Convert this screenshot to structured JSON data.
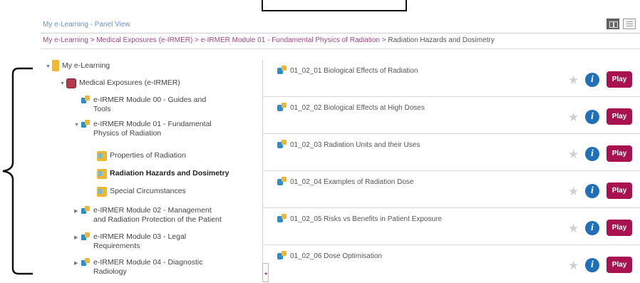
{
  "page_title": "My e-Learning - Panel View",
  "view_toggle": {
    "panel_icon": "panel-view-icon",
    "list_icon": "list-view-icon"
  },
  "breadcrumb": {
    "path": "My e-Learning > Medical Exposures (e-IRMER) > e-IRMER Module 01 - Fundamental Physics of Radiation > ",
    "current": "Radiation Hazards and Dosimetry"
  },
  "tree": {
    "root": "My e-Learning",
    "course": "Medical Exposures (e-IRMER)",
    "module00": [
      "e-IRMER Module 00 - Guides and",
      "Tools"
    ],
    "module01": [
      "e-IRMER Module 01 - Fundamental",
      "Physics of Radiation"
    ],
    "topic1": "Properties of Radiation",
    "topic2": "Radiation Hazards and Dosimetry",
    "topic3": "Special Circumstances",
    "module02": [
      "e-IRMER Module 02 - Management",
      "and Radiation Protection of the Patient"
    ],
    "module03": [
      "e-IRMER Module 03 - Legal",
      "Requirements"
    ],
    "module04": [
      "e-IRMER Module 04 - Diagnostic",
      "Radiology"
    ]
  },
  "collapse_tab": "◂",
  "lessons": [
    {
      "title": "01_02_01 Biological Effects of Radiation",
      "star": "★",
      "info": "i",
      "play": "Play"
    },
    {
      "title": "01_02_02 Biological Effects at High Doses",
      "star": "★",
      "info": "i",
      "play": "Play"
    },
    {
      "title": "01_02_03 Radiation Units and their Uses",
      "star": "★",
      "info": "i",
      "play": "Play"
    },
    {
      "title": "01_02_04 Examples of Radiation Dose",
      "star": "★",
      "info": "i",
      "play": "Play"
    },
    {
      "title": "01_02_05 Risks vs Benefits in Patient Exposure",
      "star": "★",
      "info": "i",
      "play": "Play"
    },
    {
      "title": "01_02_06 Dose Optimisation",
      "star": "★",
      "info": "i",
      "play": "Play"
    }
  ],
  "colors": {
    "accent": "#a8124f",
    "info": "#1f6fb9",
    "link": "#a0487f",
    "title": "#6d8fc8"
  }
}
